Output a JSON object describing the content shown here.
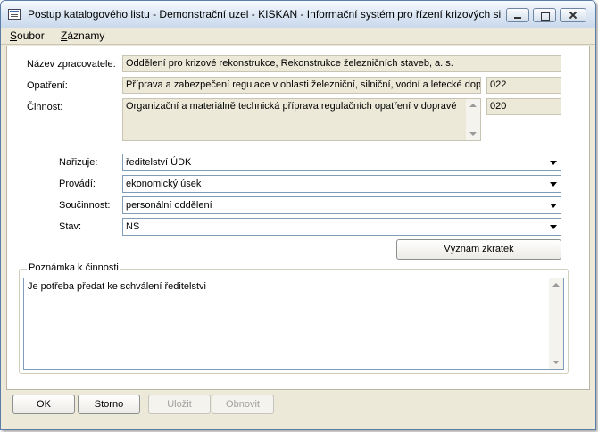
{
  "window": {
    "title": "Postup katalogového listu - Demonstrační uzel - KISKAN - Informační systém pro řízení krizových si..."
  },
  "menu": {
    "items": [
      {
        "prefix": "",
        "underline": "S",
        "rest": "oubor"
      },
      {
        "prefix": "",
        "underline": "Z",
        "rest": "áznamy"
      }
    ]
  },
  "form": {
    "nazev": {
      "label": "Název zpracovatele:",
      "value": "Oddělení pro krizové rekonstrukce, Rekonstrukce železničních staveb, a. s."
    },
    "opatreni": {
      "label": "Opatření:",
      "value": "Příprava a zabezpečení regulace v oblasti železniční, silniční, vodní a letecké dopra",
      "code": "022"
    },
    "cinnost": {
      "label": "Činnost:",
      "value": "Organizační a materiálně technická příprava regulačních opatření v dopravě",
      "code": "020"
    },
    "narizuje": {
      "label": "Nařizuje:",
      "value": "ředitelství ÚDK"
    },
    "provadi": {
      "label": "Provádí:",
      "value": "ekonomický úsek"
    },
    "soucinnost": {
      "label": "Součinnost:",
      "value": "personální oddělení"
    },
    "stav": {
      "label": "Stav:",
      "value": "NS"
    },
    "vyznam_button": "Význam zkratek",
    "poznamka": {
      "label": "Poznámka k činnosti",
      "value": "Je potřeba předat ke schválení ředitelstvi"
    }
  },
  "buttons": {
    "ok": "OK",
    "storno": "Storno",
    "ulozit": "Uložit",
    "obnovit": "Obnovit"
  }
}
